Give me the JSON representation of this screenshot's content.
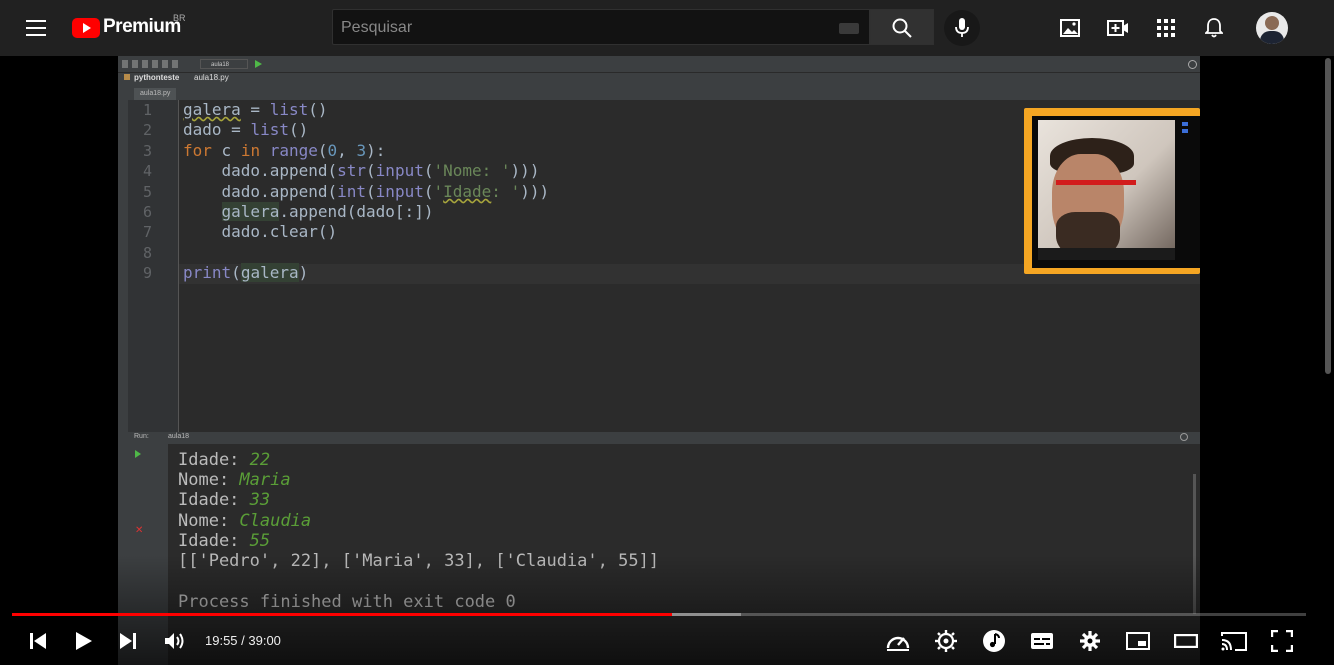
{
  "header": {
    "menu_icon": "hamburger-menu-icon",
    "logo_text": "Premium",
    "logo_country": "BR",
    "search_placeholder": "Pesquisar",
    "icons": [
      "image-upload-icon",
      "create-video-icon",
      "apps-grid-icon",
      "notifications-bell-icon"
    ]
  },
  "ide": {
    "project_name": "pythonteste",
    "file_name": "aula18.py",
    "run_config": "aula18",
    "run_label": "Run:",
    "code_lines": [
      "galera = list()",
      "dado = list()",
      "for c in range(0, 3):",
      "    dado.append(str(input('Nome: ')))",
      "    dado.append(int(input('Idade: ')))",
      "    galera.append(dado[:])",
      "    dado.clear()",
      "",
      "print(galera)"
    ],
    "line_numbers": [
      "1",
      "2",
      "3",
      "4",
      "5",
      "6",
      "7",
      "8",
      "9"
    ],
    "output": [
      {
        "label": "Idade: ",
        "value": "22"
      },
      {
        "label": "Nome: ",
        "value": "Maria"
      },
      {
        "label": "Idade: ",
        "value": "33"
      },
      {
        "label": "Nome: ",
        "value": "Claudia"
      },
      {
        "label": "Idade: ",
        "value": "55"
      }
    ],
    "result_line": "[['Pedro', 22], ['Maria', 33], ['Claudia', 55]]",
    "finish_line": "Process finished with exit code 0"
  },
  "player": {
    "time_current": "19:55",
    "time_total": "39:00",
    "time_display": "19:55 / 39:00",
    "progress_played": 0.51,
    "progress_buffered": 0.563,
    "colors": {
      "accent": "#ff0000",
      "topbar": "#212121",
      "webcam_frame": "#f5a623"
    }
  }
}
